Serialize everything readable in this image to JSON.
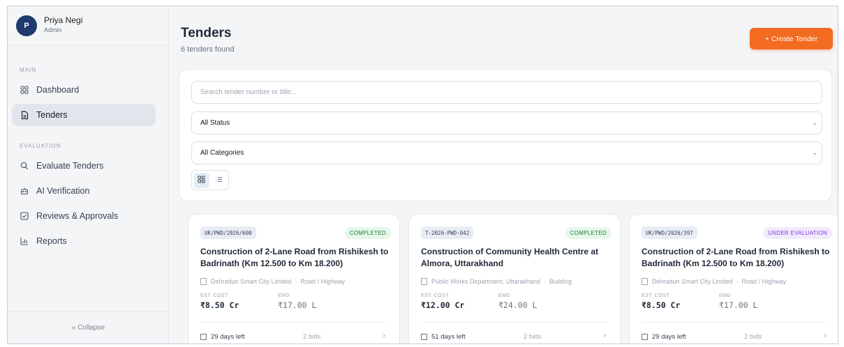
{
  "user": {
    "initial": "P",
    "name": "Priya Negi",
    "role": "Admin"
  },
  "sidebar": {
    "main_label": "MAIN",
    "evaluation_label": "EVALUATION",
    "items": [
      {
        "label": "Dashboard",
        "icon": "grid-icon"
      },
      {
        "label": "Tenders",
        "icon": "document-icon"
      },
      {
        "label": "Evaluate Tenders",
        "icon": "search-icon"
      },
      {
        "label": "AI Verification",
        "icon": "robot-icon"
      },
      {
        "label": "Reviews & Approvals",
        "icon": "checkbox-icon"
      },
      {
        "label": "Reports",
        "icon": "bar-chart-icon"
      }
    ],
    "collapse_label": "« Collapse"
  },
  "header": {
    "title": "Tenders",
    "subtitle": "6 tenders found",
    "create_label": "+ Create Tender"
  },
  "filters": {
    "search_placeholder": "Search tender number or title...",
    "status_value": "All Status",
    "category_value": "All Categories"
  },
  "cards": [
    {
      "number": "UK/PWD/2026/600",
      "status": "COMPLETED",
      "title": "Construction of 2-Lane Road from Rishikesh to Badrinath (Km 12.500 to Km 18.200)",
      "org": "Dehradun Smart City Limited",
      "category": "Road / Highway",
      "cost_label": "EST. COST",
      "cost": "₹8.50 Cr",
      "emd_label": "EMD",
      "emd": "₹17.00 L",
      "days": "29 days left",
      "bids": "2 bids"
    },
    {
      "number": "T-2026-PWD-042",
      "status": "COMPLETED",
      "title": "Construction of Community Health Centre at Almora, Uttarakhand",
      "org": "Public Works Department, Uttarakhand",
      "category": "Building",
      "cost_label": "EST. COST",
      "cost": "₹12.00 Cr",
      "emd_label": "EMD",
      "emd": "₹24.00 L",
      "days": "51 days left",
      "bids": "2 bids"
    },
    {
      "number": "UK/PWD/2026/397",
      "status": "UNDER EVALUATION",
      "title": "Construction of 2-Lane Road from Rishikesh to Badrinath (Km 12.500 to Km 18.200)",
      "org": "Dehradun Smart City Limited",
      "category": "Road / Highway",
      "cost_label": "EST. COST",
      "cost": "₹8.50 Cr",
      "emd_label": "EMD",
      "emd": "₹17.00 L",
      "days": "29 days left",
      "bids": "2 bids"
    }
  ],
  "colors": {
    "accent": "#f36b21",
    "avatar": "#1e3a6e",
    "completed": "#1f7a3a",
    "evaluation": "#7c3aed"
  }
}
